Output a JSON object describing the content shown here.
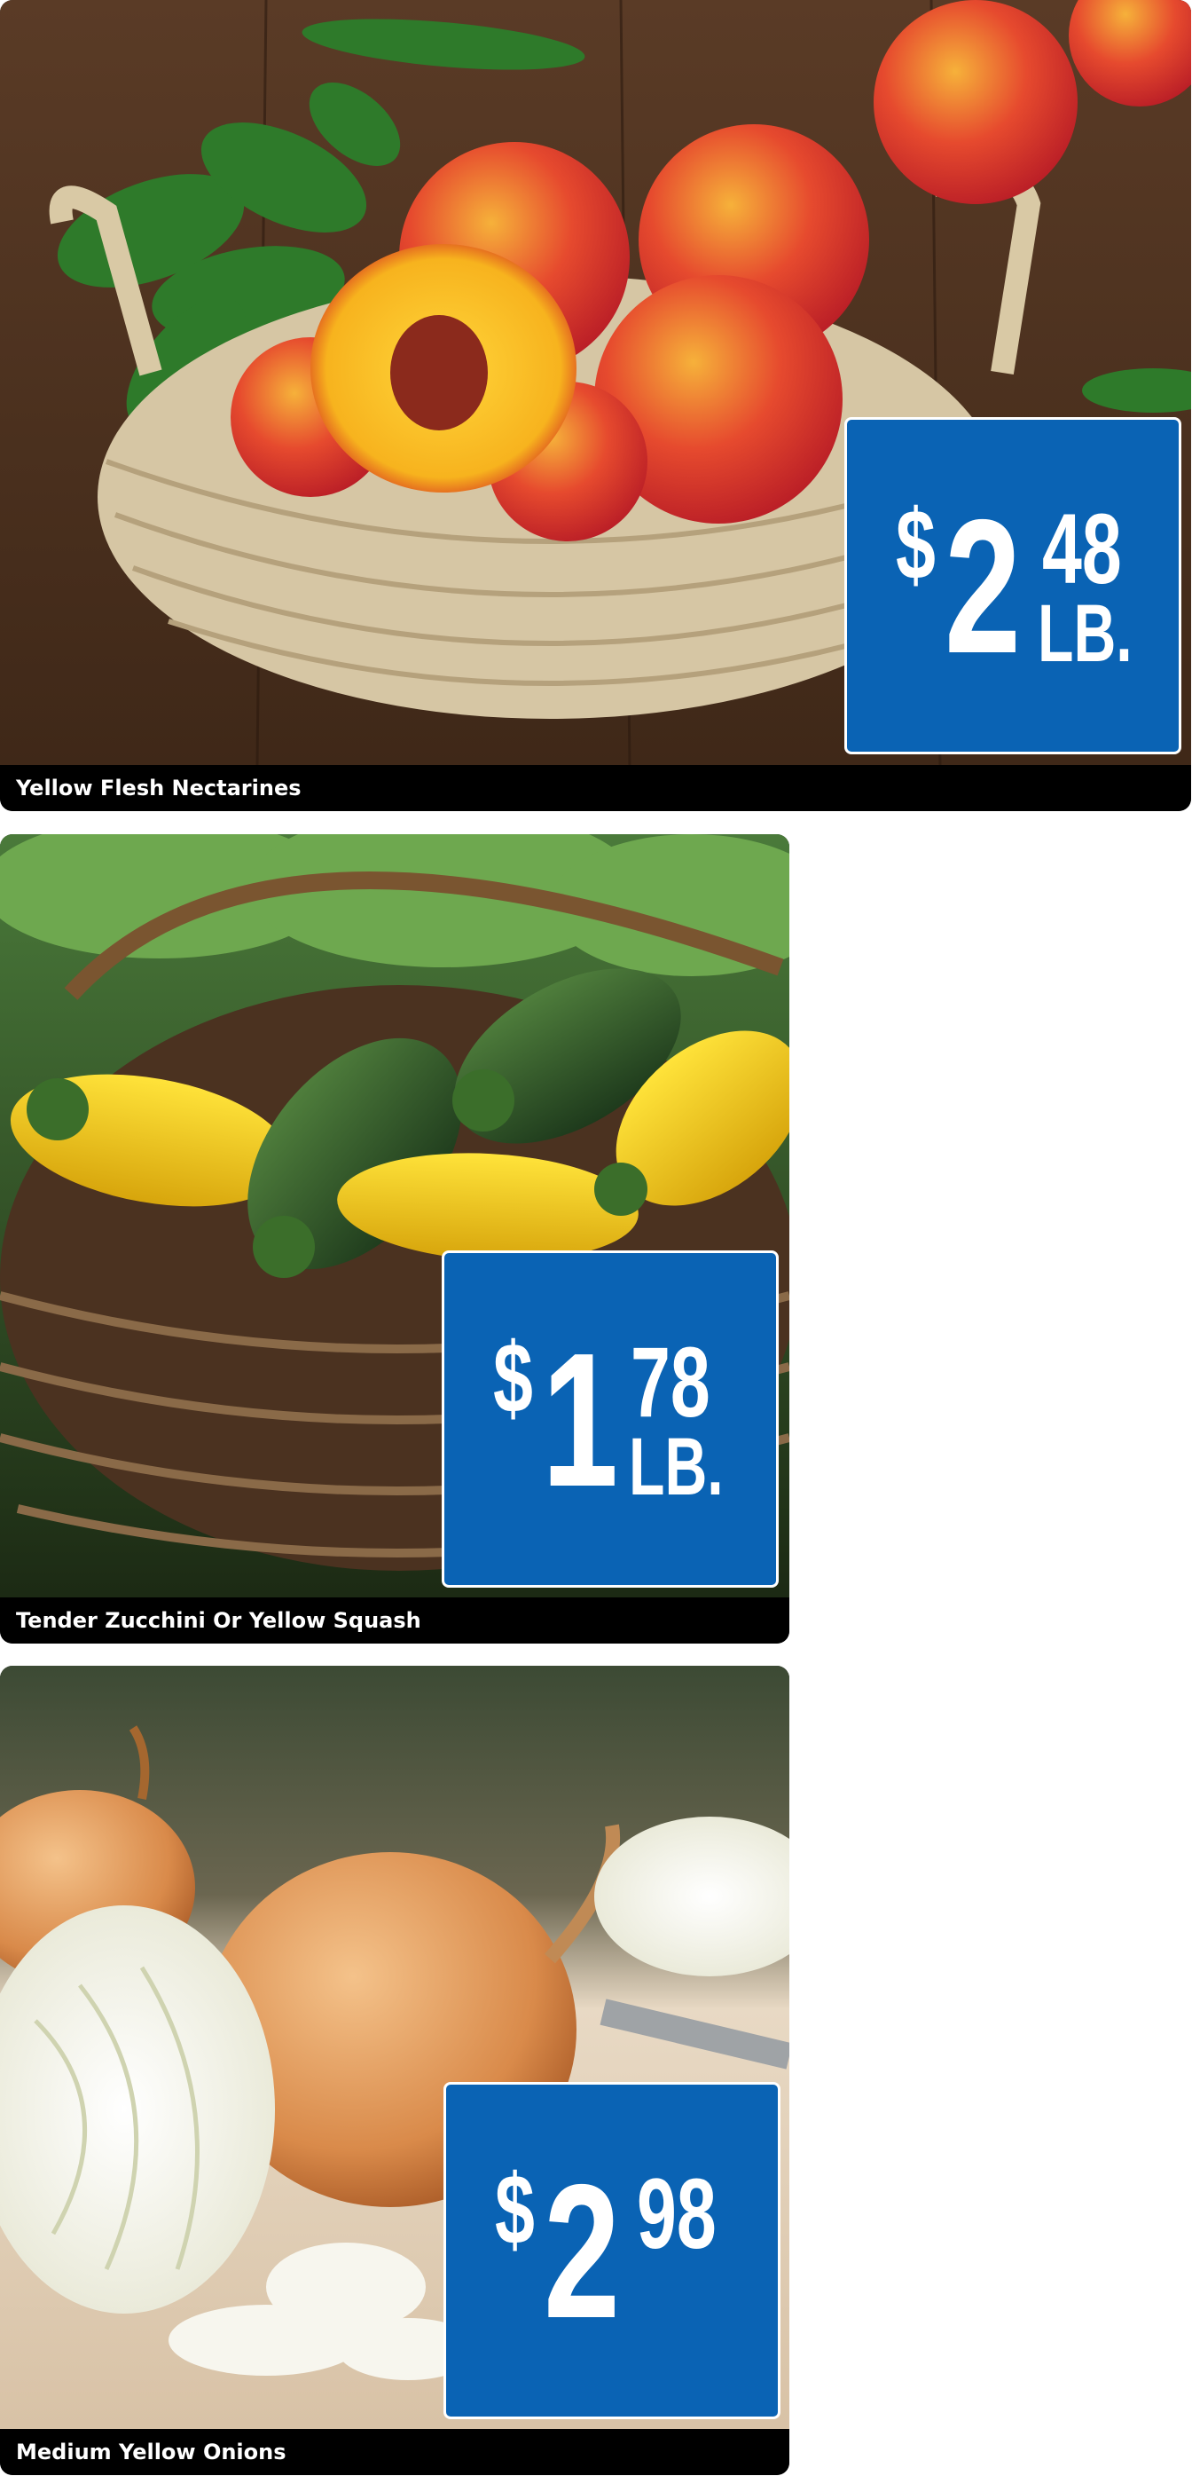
{
  "products": [
    {
      "name": "Yellow Flesh Nectarines",
      "image_subject": "nectarines-in-wicker-basket",
      "price": {
        "symbol": "$",
        "whole": "2",
        "cents": "48",
        "unit": "LB."
      }
    },
    {
      "name": "Tender Zucchini Or Yellow Squash",
      "image_subject": "zucchini-and-squash-in-basket",
      "price": {
        "symbol": "$",
        "whole": "1",
        "cents": "78",
        "unit": "LB."
      }
    },
    {
      "name": "Medium Yellow Onions",
      "image_subject": "yellow-onions-on-board",
      "price": {
        "symbol": "$",
        "whole": "2",
        "cents": "98",
        "unit": ""
      }
    }
  ],
  "colors": {
    "price_tag_background": "#0a63b4",
    "caption_background": "#000000",
    "caption_text": "#ffffff"
  }
}
